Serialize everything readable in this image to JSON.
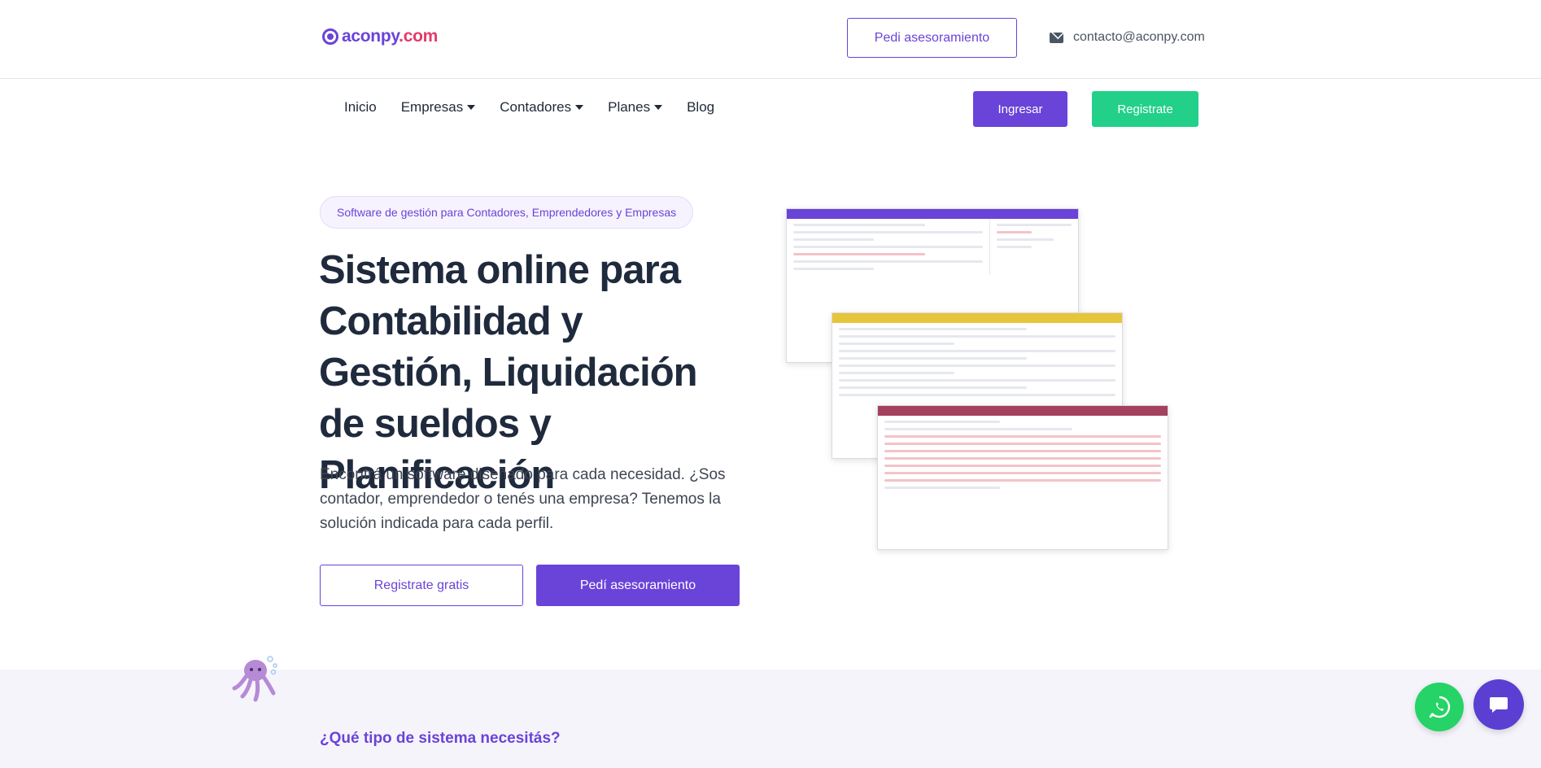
{
  "header": {
    "logo_text": "aconpy",
    "logo_suffix": ".com",
    "advice_label": "Pedi asesoramiento",
    "contact_email": "contacto@aconpy.com"
  },
  "nav": {
    "items": [
      {
        "label": "Inicio",
        "dropdown": false
      },
      {
        "label": "Empresas",
        "dropdown": true
      },
      {
        "label": "Contadores",
        "dropdown": true
      },
      {
        "label": "Planes",
        "dropdown": true
      },
      {
        "label": "Blog",
        "dropdown": false
      }
    ],
    "login_label": "Ingresar",
    "register_label": "Registrate"
  },
  "hero": {
    "pill": "Software de gestión para Contadores, Emprendedores y Empresas",
    "title": "Sistema online para Contabilidad y Gestión, Liquidación de sueldos y Planificación",
    "text": "Encontrá un software diseñado para cada necesidad. ¿Sos contador, emprendedor o tenés una empresa? Tenemos la solución indicada para cada perfil.",
    "register_free_label": "Registrate gratis",
    "advice_label": "Pedí asesoramiento"
  },
  "section": {
    "question": "¿Qué tipo de sistema necesitás?"
  },
  "colors": {
    "brand": "#6a43d8",
    "accent_green": "#22d08a",
    "whatsapp": "#25d366"
  },
  "icons": {
    "mail": "mail-icon",
    "whatsapp": "whatsapp-icon",
    "chat": "chat-bubble-icon"
  }
}
